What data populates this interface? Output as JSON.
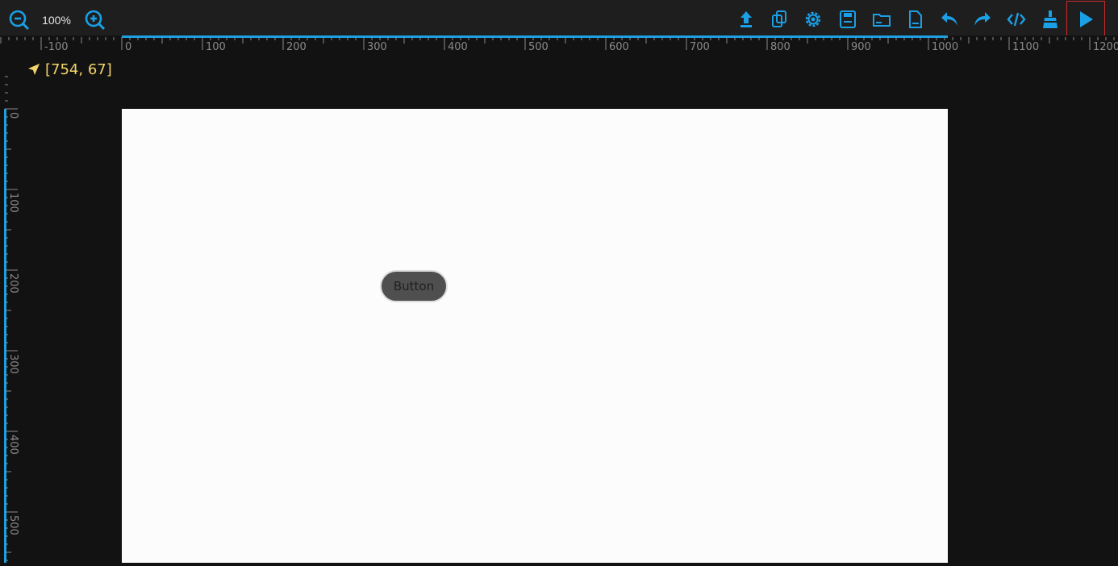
{
  "toolbar": {
    "zoom_level": "100%",
    "zoom_out_icon": "zoom-out-icon",
    "zoom_in_icon": "zoom-in-icon",
    "actions": [
      {
        "name": "upload-icon"
      },
      {
        "name": "duplicate-icon"
      },
      {
        "name": "settings-icon"
      },
      {
        "name": "save-icon"
      },
      {
        "name": "open-folder-icon"
      },
      {
        "name": "new-file-icon"
      },
      {
        "name": "undo-icon"
      },
      {
        "name": "redo-icon"
      },
      {
        "name": "code-icon"
      },
      {
        "name": "clean-icon"
      },
      {
        "name": "run-icon",
        "highlighted": true
      }
    ],
    "accent_color": "#1aa0e6",
    "highlight_color": "#cc2a2a"
  },
  "rulers": {
    "horizontal_labels": [
      "-100",
      "0",
      "100",
      "200",
      "300",
      "400",
      "500",
      "600",
      "700",
      "800",
      "900",
      "1000",
      "1100",
      "1200"
    ],
    "vertical_labels": [
      "0",
      "100",
      "200",
      "300",
      "400",
      "500"
    ],
    "accent_color": "#1aa0e6"
  },
  "cursor": {
    "coordinates": "[754, 67]",
    "icon": "navigation-arrow-icon",
    "color": "#f2d46b"
  },
  "canvas": {
    "background": "#fcfcfc",
    "button_label": "Button"
  }
}
